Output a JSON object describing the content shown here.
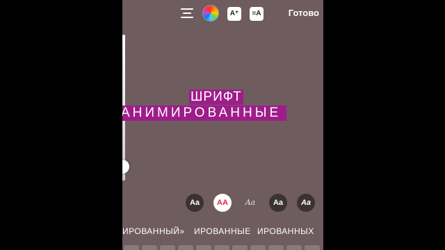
{
  "toolbar": {
    "effects_icon_text": "A⁺",
    "animation_icon_text": "≡A",
    "done_label": "Готово"
  },
  "text_content": {
    "line1": "ШРИФТ",
    "line2": "АНИМИРОВАННЫЕ"
  },
  "font_styles": [
    {
      "label": "Aa",
      "icon": "font-classic"
    },
    {
      "label": "AA",
      "icon": "font-strong"
    },
    {
      "label": "Aa",
      "icon": "font-script"
    },
    {
      "label": "Aa",
      "icon": "font-typewriter"
    },
    {
      "label": "Aa",
      "icon": "font-bold-italic"
    }
  ],
  "animation_styles": [
    {
      "label": "ИРОВАННЫЙ»"
    },
    {
      "label": "ИРОВАННЫЕ"
    },
    {
      "label": "ИРОВАННЫХ"
    }
  ],
  "colors": {
    "background": "#6f5c5e",
    "text_highlight": "#9e1d8a",
    "selected_font_text": "#d32f2f"
  }
}
